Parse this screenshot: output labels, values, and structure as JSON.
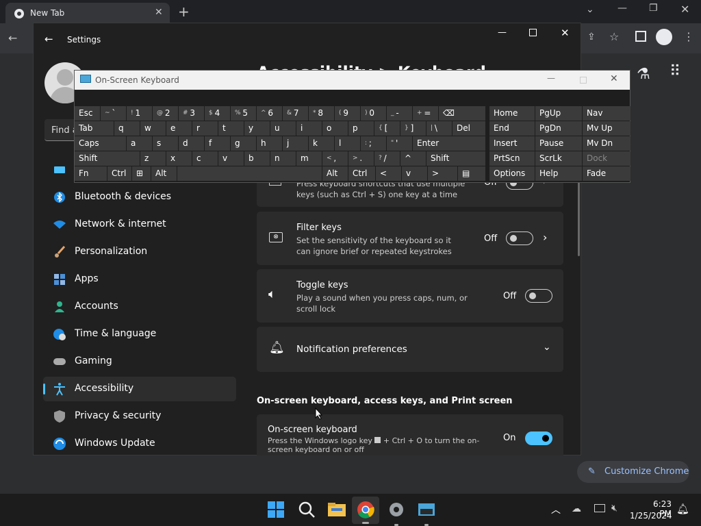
{
  "chrome": {
    "tab_title": "New Tab",
    "customize_label": "Customize Chrome"
  },
  "settings": {
    "title": "Settings",
    "search_placeholder": "Find a",
    "page_title": "Accessibility > Keyboard",
    "nav": [
      {
        "label": "Bluetooth & devices",
        "icon": "bluetooth-icon"
      },
      {
        "label": "Network & internet",
        "icon": "wifi-icon"
      },
      {
        "label": "Personalization",
        "icon": "brush-icon"
      },
      {
        "label": "Apps",
        "icon": "apps-icon"
      },
      {
        "label": "Accounts",
        "icon": "person-icon"
      },
      {
        "label": "Time & language",
        "icon": "globe-clock-icon"
      },
      {
        "label": "Gaming",
        "icon": "gamepad-icon"
      },
      {
        "label": "Accessibility",
        "icon": "accessibility-icon"
      },
      {
        "label": "Privacy & security",
        "icon": "shield-icon"
      },
      {
        "label": "Windows Update",
        "icon": "update-icon"
      }
    ],
    "sticky": {
      "desc": "Press keyboard shortcuts that use multiple keys (such as Ctrl + S) one key at a time",
      "state": "Off"
    },
    "filter": {
      "title": "Filter keys",
      "desc": "Set the sensitivity of the keyboard so it can ignore brief or repeated keystrokes",
      "state": "Off"
    },
    "toggle_keys": {
      "title": "Toggle keys",
      "desc": "Play a sound when you press caps, num, or scroll lock",
      "state": "Off"
    },
    "notif": {
      "title": "Notification preferences"
    },
    "section_heading": "On-screen keyboard, access keys, and Print screen",
    "osk_setting": {
      "title": "On-screen keyboard",
      "desc_pre": "Press the Windows logo key",
      "desc_post": "+ Ctrl + O to turn the on-screen keyboard on or off",
      "state": "On"
    }
  },
  "osk": {
    "title": "On-Screen Keyboard",
    "rows": [
      [
        {
          "l": "Esc"
        },
        {
          "s": "~",
          "l": "`"
        },
        {
          "s": "!",
          "l": "1"
        },
        {
          "s": "@",
          "l": "2"
        },
        {
          "s": "#",
          "l": "3"
        },
        {
          "s": "$",
          "l": "4"
        },
        {
          "s": "%",
          "l": "5"
        },
        {
          "s": "^",
          "l": "6"
        },
        {
          "s": "&",
          "l": "7"
        },
        {
          "s": "*",
          "l": "8"
        },
        {
          "s": "(",
          "l": "9"
        },
        {
          "s": ")",
          "l": "0"
        },
        {
          "s": "_",
          "l": "-"
        },
        {
          "s": "+",
          "l": "="
        },
        {
          "l": "⌫"
        }
      ],
      [
        {
          "l": "Tab"
        },
        {
          "l": "q"
        },
        {
          "l": "w"
        },
        {
          "l": "e"
        },
        {
          "l": "r"
        },
        {
          "l": "t"
        },
        {
          "l": "y"
        },
        {
          "l": "u"
        },
        {
          "l": "i"
        },
        {
          "l": "o"
        },
        {
          "l": "p"
        },
        {
          "s": "{",
          "l": "["
        },
        {
          "s": "}",
          "l": "]"
        },
        {
          "s": "|",
          "l": "\\"
        },
        {
          "l": "Del"
        }
      ],
      [
        {
          "l": "Caps"
        },
        {
          "l": "a"
        },
        {
          "l": "s"
        },
        {
          "l": "d"
        },
        {
          "l": "f"
        },
        {
          "l": "g"
        },
        {
          "l": "h"
        },
        {
          "l": "j"
        },
        {
          "l": "k"
        },
        {
          "l": "l"
        },
        {
          "s": ":",
          "l": ";"
        },
        {
          "s": "\"",
          "l": "'"
        },
        {
          "l": "Enter"
        }
      ],
      [
        {
          "l": "Shift"
        },
        {
          "l": "z"
        },
        {
          "l": "x"
        },
        {
          "l": "c"
        },
        {
          "l": "v"
        },
        {
          "l": "b"
        },
        {
          "l": "n"
        },
        {
          "l": "m"
        },
        {
          "s": "<",
          "l": ","
        },
        {
          "s": ">",
          "l": "."
        },
        {
          "s": "?",
          "l": "/"
        },
        {
          "l": "^"
        },
        {
          "l": "Shift"
        }
      ],
      [
        {
          "l": "Fn"
        },
        {
          "l": "Ctrl"
        },
        {
          "l": "⊞"
        },
        {
          "l": "Alt"
        },
        {
          "l": ""
        },
        {
          "l": "Alt"
        },
        {
          "l": "Ctrl"
        },
        {
          "l": "<"
        },
        {
          "l": "v"
        },
        {
          "l": ">"
        },
        {
          "l": "▤"
        }
      ]
    ],
    "nav_rows": [
      [
        "Home",
        "PgUp",
        "Nav"
      ],
      [
        "End",
        "PgDn",
        "Mv Up"
      ],
      [
        "Insert",
        "Pause",
        "Mv Dn"
      ],
      [
        "PrtScn",
        "ScrLk",
        "Dock"
      ],
      [
        "Options",
        "Help",
        "Fade"
      ]
    ]
  },
  "taskbar": {
    "time": "6:23 PM",
    "date": "1/25/2024"
  }
}
